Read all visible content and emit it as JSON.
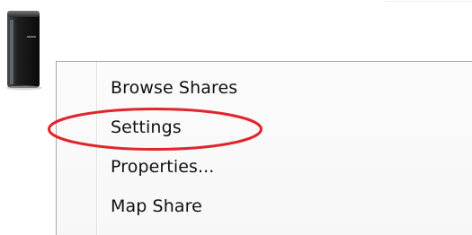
{
  "device": {
    "icon": "nas-drive-icon"
  },
  "context_menu": {
    "items": [
      {
        "label": "Browse Shares"
      },
      {
        "label": "Settings"
      },
      {
        "label": "Properties..."
      },
      {
        "label": "Map Share"
      }
    ]
  },
  "annotation": {
    "highlight_color": "#e0262c",
    "highlighted_item": "Settings"
  }
}
